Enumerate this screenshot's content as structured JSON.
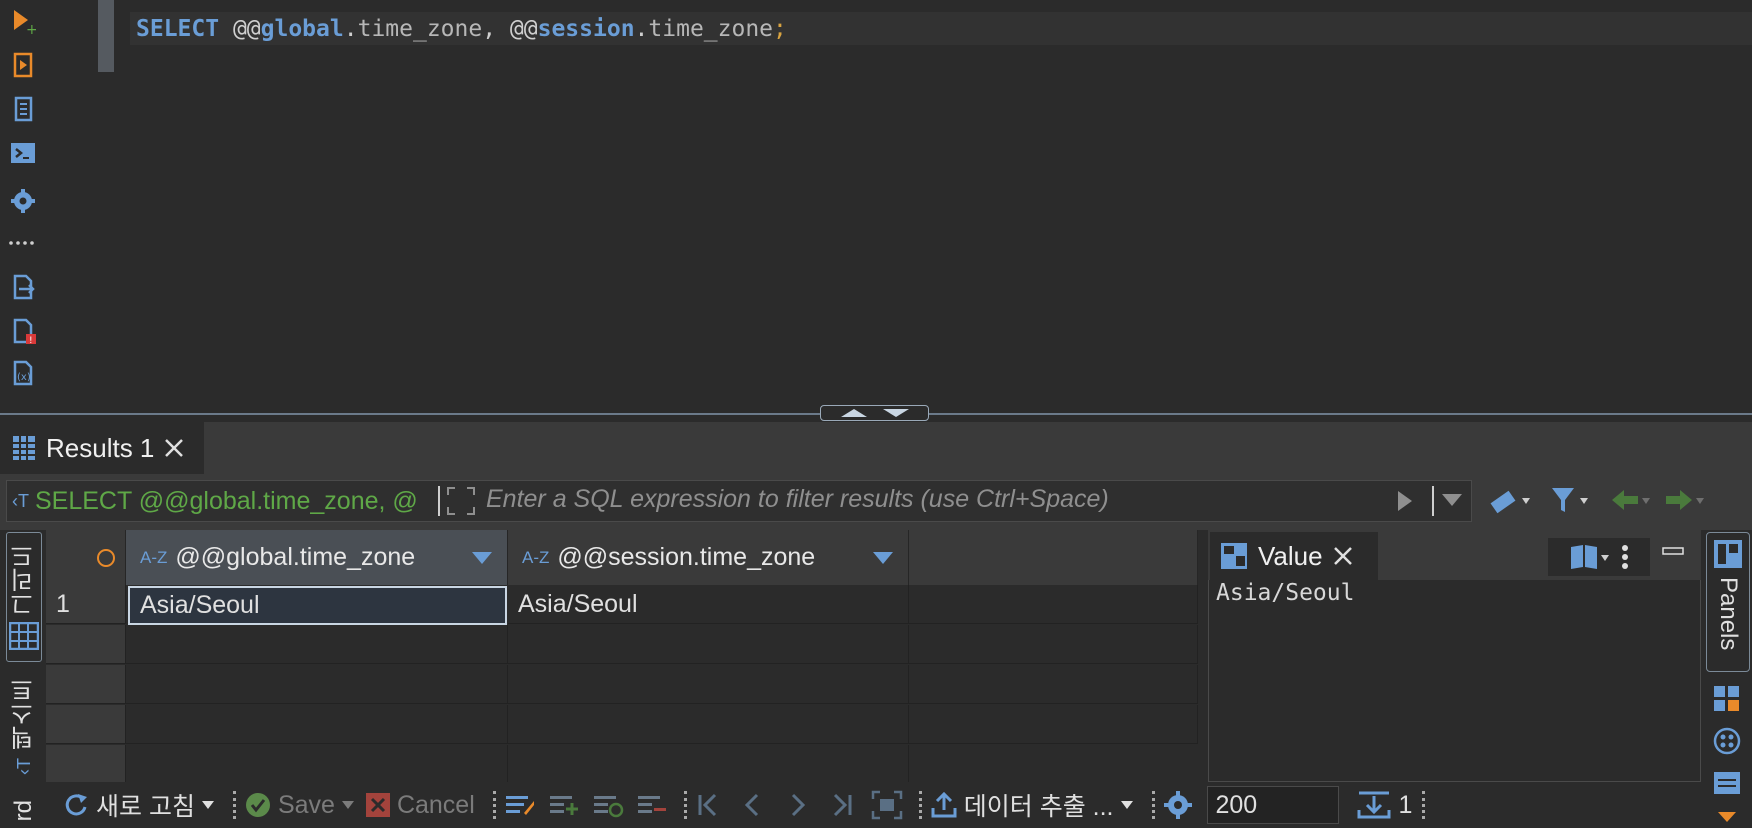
{
  "editor": {
    "code_tokens": {
      "select": "SELECT",
      "at1": " @@",
      "global": "global",
      "dot1": ".",
      "field1": "time_zone",
      "comma": ", @@",
      "session": "session",
      "dot2": ".",
      "field2": "time_zone",
      "semi": ";"
    }
  },
  "left_toolbar": {
    "icons": [
      "execute-statement-icon",
      "execute-script-icon",
      "script-list-icon",
      "terminal-icon",
      "settings-icon",
      "more-icon",
      "export-icon",
      "problem-file-icon",
      "variables-icon"
    ]
  },
  "results": {
    "tab_label": "Results 1",
    "filter": {
      "sql_chip": "SELECT @@global.time_zone, @",
      "placeholder": "Enter a SQL expression to filter results (use Ctrl+Space)"
    },
    "columns": [
      {
        "type_badge": "A-Z",
        "name": "@@global.time_zone"
      },
      {
        "type_badge": "A-Z",
        "name": "@@session.time_zone"
      }
    ],
    "rows": [
      {
        "num": "1",
        "values": [
          "Asia/Seoul",
          "Asia/Seoul"
        ]
      }
    ],
    "side_tabs": {
      "grid": "그리드",
      "text": "텍스트",
      "record": "rd"
    }
  },
  "value_panel": {
    "tab_label": "Value",
    "value": "Asia/Seoul"
  },
  "panels_label": "Panels",
  "bottom_toolbar": {
    "refresh": "새로 고침",
    "save": "Save",
    "cancel": "Cancel",
    "export": "데이터 추출 ...",
    "limit": "200",
    "row_count": "1"
  },
  "colors": {
    "background": "#2b2b2b",
    "accent_blue": "#6a9dd6",
    "filter_sql_green": "#5fa847",
    "semicolon": "#d9a441"
  }
}
